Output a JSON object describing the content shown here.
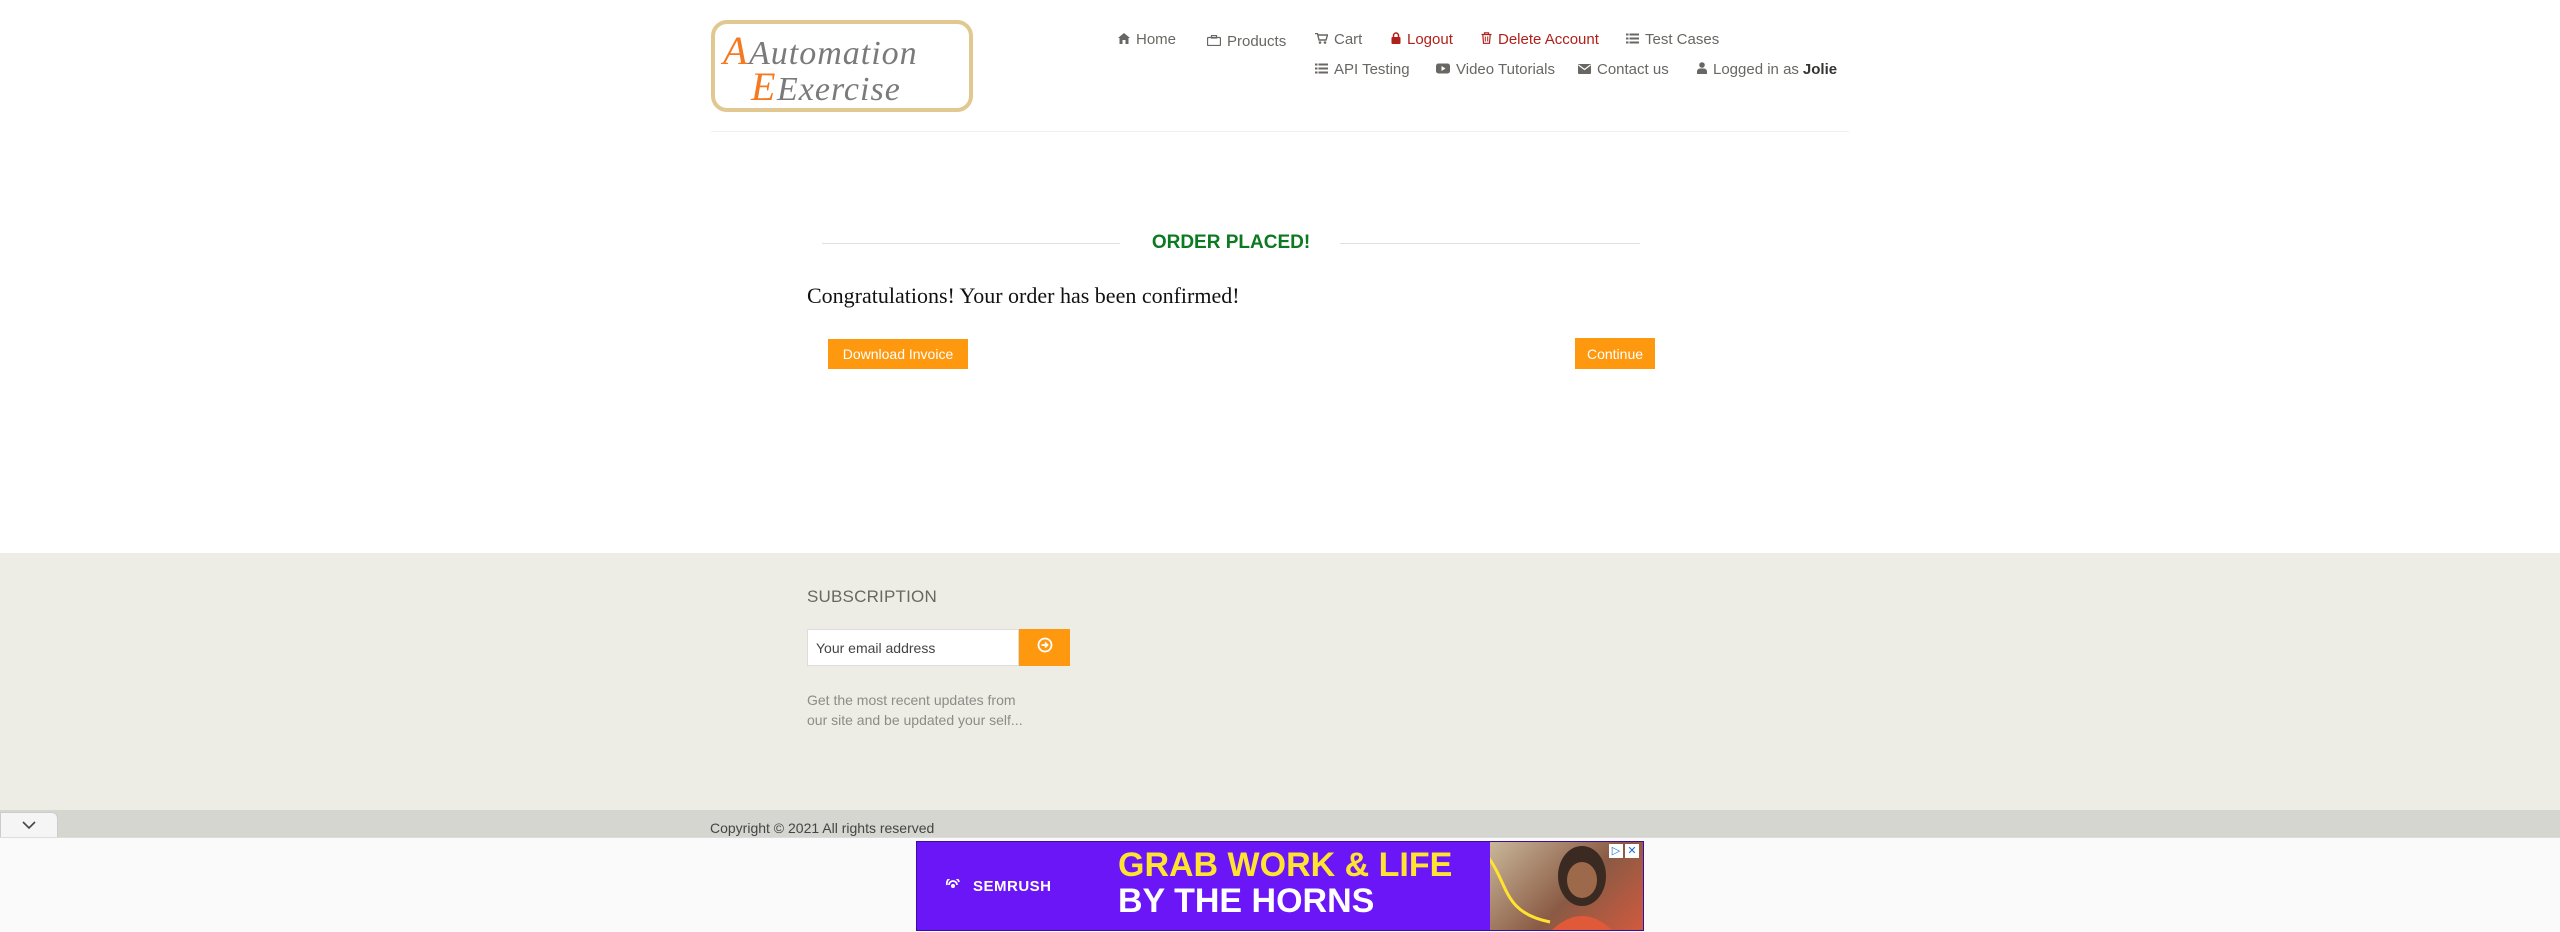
{
  "header": {
    "logo": {
      "line1": "Automation",
      "line2": "Exercise"
    },
    "nav": {
      "home": "Home",
      "products": "Products",
      "cart": "Cart",
      "logout": "Logout",
      "delete_account": "Delete Account",
      "test_cases": "Test Cases",
      "api_testing": "API Testing",
      "video_tutorials": "Video Tutorials",
      "contact_us": "Contact us",
      "logged_in_prefix": "Logged in as",
      "logged_in_user": "Jolie"
    }
  },
  "order": {
    "title": "ORDER PLACED!",
    "message": "Congratulations! Your order has been confirmed!",
    "download_invoice": "Download Invoice",
    "continue": "Continue"
  },
  "footer": {
    "subscription_title": "SUBSCRIPTION",
    "email_placeholder": "Your email address",
    "subscription_text": "Get the most recent updates from our site and be updated your self...",
    "copyright": "Copyright © 2021 All rights reserved"
  },
  "ad": {
    "brand": "SEMRUSH",
    "headline_line1": "GRAB WORK & LIFE",
    "headline_line2": "BY THE HORNS"
  },
  "colors": {
    "accent": "#fe980f",
    "success": "#0c7a21",
    "danger": "#b0201a",
    "footer_bg": "#edede5",
    "ad_bg": "#6b16f6",
    "ad_headline": "#ffe330"
  }
}
